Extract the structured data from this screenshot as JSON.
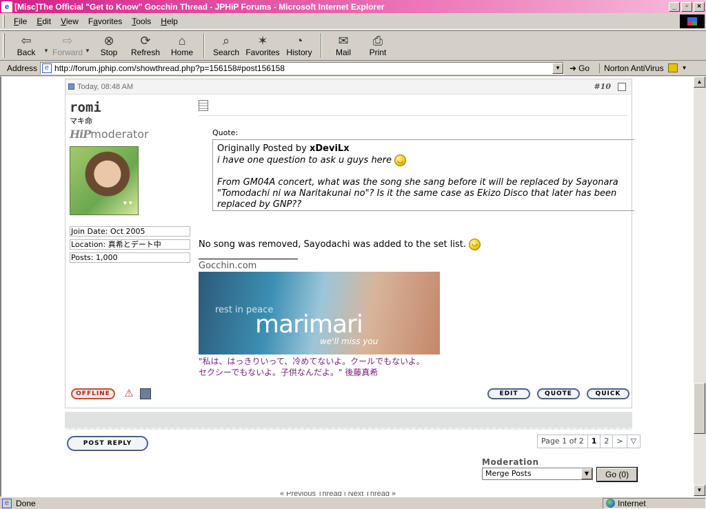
{
  "window": {
    "title": "[Misc]The Official \"Get to Know\" Gocchin Thread - JPHiP Forums - Microsoft Internet Explorer",
    "controls": [
      "_",
      "▫",
      "×"
    ]
  },
  "menu": [
    {
      "label": "File",
      "key": "F",
      "rest": "ile"
    },
    {
      "label": "Edit",
      "key": "E",
      "rest": "dit"
    },
    {
      "label": "View",
      "key": "V",
      "rest": "iew"
    },
    {
      "label": "Favorites",
      "key": "a",
      "pre": "F",
      "rest": "vorites"
    },
    {
      "label": "Tools",
      "key": "T",
      "rest": "ools"
    },
    {
      "label": "Help",
      "key": "H",
      "rest": "elp"
    }
  ],
  "toolbar": {
    "back": "Back",
    "forward": "Forward",
    "stop": "Stop",
    "refresh": "Refresh",
    "home": "Home",
    "search": "Search",
    "favorites": "Favorites",
    "history": "History",
    "mail": "Mail",
    "print": "Print"
  },
  "address": {
    "label": "Address",
    "url": "http://forum.jphip.com/showthread.php?p=156158#post156158",
    "go": "Go",
    "norton": "Norton AntiVirus"
  },
  "post": {
    "timestamp": "Today, 08:48 AM",
    "number": "#10",
    "user": {
      "name": "romi",
      "title": "マキ命",
      "rank_logo": "HiP",
      "rank": "moderator",
      "join_date": "Join Date: Oct 2005",
      "location": "Location: 真希とデート中",
      "posts": "Posts: 1,000"
    },
    "quote": {
      "label": "Quote:",
      "originally": "Originally Posted by",
      "author": "xDeviLx",
      "line1": "i have one question to ask u guys here",
      "line2": "From GM04A concert, what was the song she sang before it will be replaced by Sayonara",
      "line3": "\"Tomodachi ni wa Naritakunai no\"? Is it the same case as Ekizo Disco that later has been",
      "line4": "replaced by GNP??"
    },
    "reply": "No song was removed, Sayodachi was added to the set list.",
    "signature": {
      "site": "Gocchin.com",
      "banner_small": "rest in peace",
      "banner_big": "marimari",
      "banner_sub": "we'll miss you",
      "jp_line1": "\"私は、はっきりいって、冷めてないよ。クールでもないよ。",
      "jp_line2": "セクシーでもないよ。子供なんだよ。\" 後藤真希"
    },
    "buttons": {
      "offline": "OFFLINE",
      "edit": "EDIT",
      "quote": "QUOTE",
      "quick": "QUICK"
    }
  },
  "post_reply": "POST REPLY",
  "pagination": {
    "label": "Page 1 of 2",
    "pages": [
      "1",
      "2"
    ],
    "next": ">",
    "menu": "▽"
  },
  "moderation": {
    "label": "Moderation",
    "selected": "Merge Posts",
    "go": "Go (0)"
  },
  "footer_cut": "« Previous Thread | Next Thread »",
  "status": {
    "text": "Done",
    "zone": "Internet"
  }
}
